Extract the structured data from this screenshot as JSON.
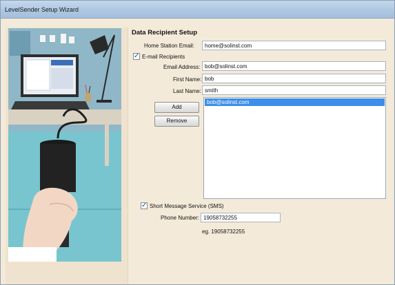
{
  "window": {
    "title": "LevelSender Setup Wizard"
  },
  "section": {
    "title": "Data Recipient Setup"
  },
  "home_station": {
    "label": "Home Station Email:",
    "value": "home@solinst.com"
  },
  "email_recipients": {
    "checkbox_label": "E-mail Recipients",
    "checked": true,
    "email_label": "Email Address:",
    "email_value": "bob@solinst.com",
    "first_name_label": "First Name:",
    "first_name_value": "bob",
    "last_name_label": "Last Name:",
    "last_name_value": "smith",
    "add_label": "Add",
    "remove_label": "Remove",
    "list": [
      "bob@solinst.com"
    ]
  },
  "sms": {
    "checkbox_label": "Short Message Service (SMS)",
    "checked": true,
    "phone_label": "Phone Number:",
    "phone_value": "19058732255",
    "hint": "eg. 19058732255"
  },
  "colors": {
    "selection": "#3d8ee8",
    "background": "#f4ead9",
    "titlebar": "#aec8e3"
  },
  "icons": {
    "checkmark": "check-icon"
  }
}
